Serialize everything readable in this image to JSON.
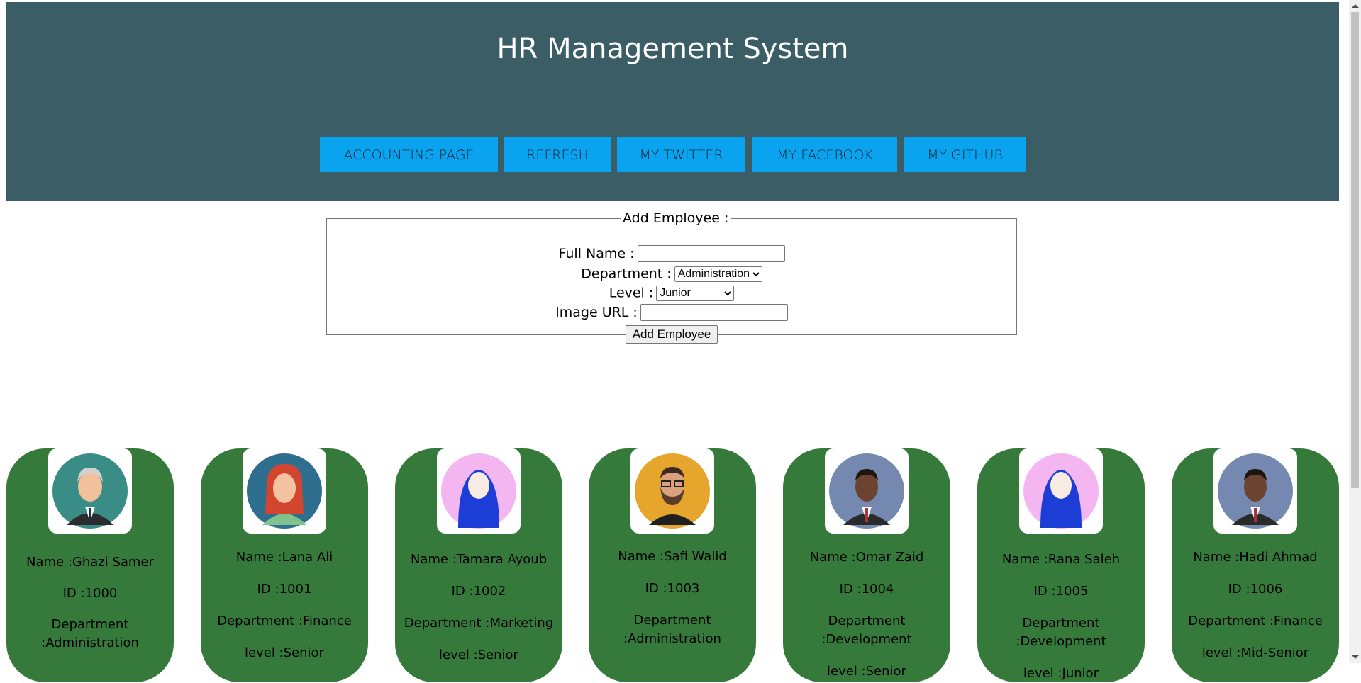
{
  "header": {
    "title": "HR Management System",
    "nav": [
      "Accounting Page",
      "Refresh",
      "My Twitter",
      "My Facebook",
      "My Github"
    ]
  },
  "form": {
    "legend": "Add Employee :",
    "full_name_label": "Full Name :",
    "full_name_value": "",
    "department_label": "Department :",
    "department_value": "Administration",
    "level_label": "Level :",
    "level_value": "Junior",
    "image_url_label": "Image URL :",
    "image_url_value": "",
    "submit_label": "Add Employee"
  },
  "employees": [
    {
      "name": "Name :Ghazi Samer",
      "id": "ID :1000",
      "department": "Department :Administration",
      "level": "",
      "avatar": "senior-man-avatar-icon"
    },
    {
      "name": "Name :Lana Ali",
      "id": "ID :1001",
      "department": "Department :Finance",
      "level": "level :Senior",
      "avatar": "red-haired-woman-avatar-icon"
    },
    {
      "name": "Name :Tamara Ayoub",
      "id": "ID :1002",
      "department": "Department :Marketing",
      "level": "level :Senior",
      "avatar": "hijab-woman-avatar-icon"
    },
    {
      "name": "Name :Safi Walid",
      "id": "ID :1003",
      "department": "Department :Administration",
      "level": "",
      "avatar": "bearded-man-avatar-icon"
    },
    {
      "name": "Name :Omar Zaid",
      "id": "ID :1004",
      "department": "Department :Development",
      "level": "level :Senior",
      "avatar": "man-in-suit-avatar-icon"
    },
    {
      "name": "Name :Rana Saleh",
      "id": "ID :1005",
      "department": "Department :Development",
      "level": "level :Junior",
      "avatar": "hijab-woman-avatar-icon"
    },
    {
      "name": "Name :Hadi Ahmad",
      "id": "ID :1006",
      "department": "Department :Finance",
      "level": "level :Mid-Senior",
      "avatar": "man-in-suit-avatar-icon"
    }
  ],
  "colors": {
    "header_bg": "#3b5d66",
    "nav_button_bg": "#0aa3ef",
    "card_bg": "#367a3b"
  }
}
